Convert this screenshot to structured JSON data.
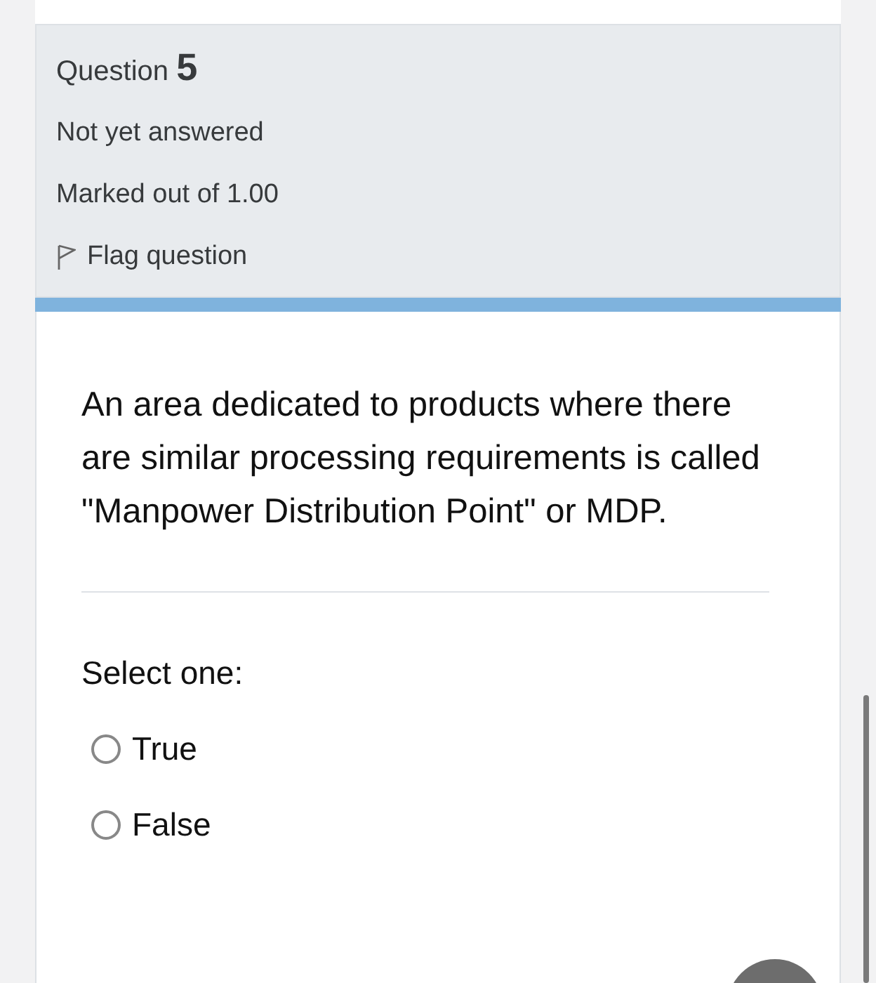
{
  "question": {
    "label": "Question",
    "number": "5",
    "status": "Not yet answered",
    "marks": "Marked out of 1.00",
    "flag": {
      "label": "Flag question",
      "flagged": false
    }
  },
  "text": "An area dedicated to products where there are similar processing requirements is called \"Manpower Distribution Point\" or MDP.",
  "prompt": "Select one:",
  "options": [
    {
      "label": "True",
      "selected": false
    },
    {
      "label": "False",
      "selected": false
    }
  ]
}
